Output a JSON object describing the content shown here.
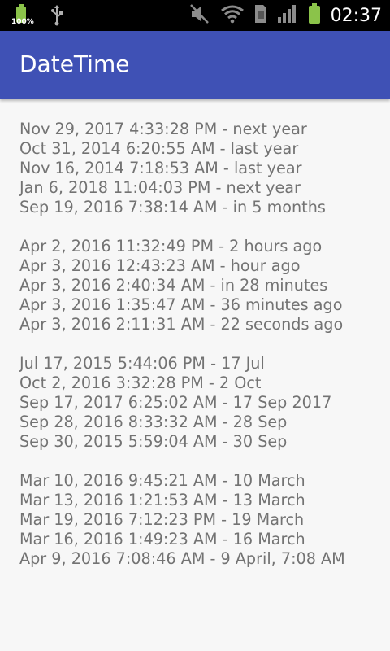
{
  "status_bar": {
    "battery_percent": "100%",
    "time": "02:37",
    "icons": [
      "battery-icon",
      "usb-icon",
      "mute-icon",
      "wifi-icon",
      "sim-icon",
      "signal-icon",
      "battery-icon"
    ],
    "battery_color": "#8bc34a"
  },
  "app_bar": {
    "title": "DateTime",
    "color": "#3f51b5"
  },
  "groups": [
    [
      "Nov 29, 2017 4:33:28 PM  -  next year",
      "Oct 31, 2014 6:20:55 AM  -  last year",
      "Nov 16, 2014 7:18:53 AM  -  last year",
      "Jan 6, 2018 11:04:03 PM  -  next year",
      "Sep 19, 2016 7:38:14 AM  -  in 5 months"
    ],
    [
      "Apr 2, 2016 11:32:49 PM  -  2 hours ago",
      "Apr 3, 2016 12:43:23 AM  -  hour ago",
      "Apr 3, 2016 2:40:34 AM  -  in 28 minutes",
      "Apr 3, 2016 1:35:47 AM  -  36 minutes ago",
      "Apr 3, 2016 2:11:31 AM  -  22 seconds ago"
    ],
    [
      "Jul 17, 2015 5:44:06 PM  -  17 Jul",
      "Oct 2, 2016 3:32:28 PM  -  2 Oct",
      "Sep 17, 2017 6:25:02 AM  -  17 Sep 2017",
      "Sep 28, 2016 8:33:32 AM  -  28 Sep",
      "Sep 30, 2015 5:59:04 AM  -  30 Sep"
    ],
    [
      "Mar 10, 2016 9:45:21 AM  -  10 March",
      "Mar 13, 2016 1:21:53 AM  -  13 March",
      "Mar 19, 2016 7:12:23 PM  -  19 March",
      "Mar 16, 2016 1:49:23 AM  -  16 March",
      "Apr 9, 2016 7:08:46 AM  -  9 April, 7:08 AM"
    ]
  ]
}
